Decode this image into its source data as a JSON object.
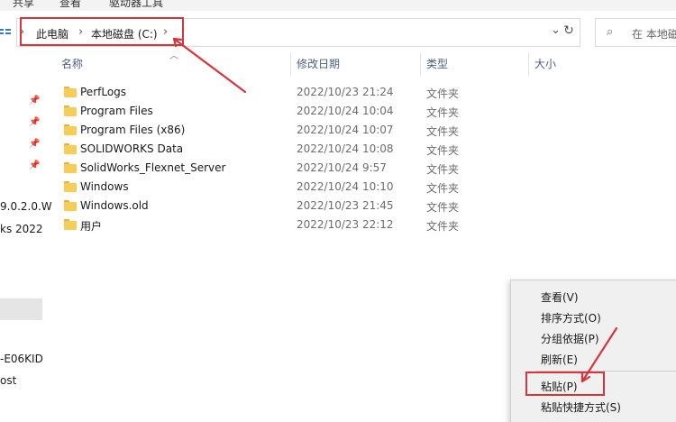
{
  "ribbon": {
    "tabs": [
      "共享",
      "查看",
      "驱动器工具"
    ]
  },
  "breadcrumb": {
    "items": [
      "此电脑",
      "本地磁盘 (C:)"
    ]
  },
  "search": {
    "placeholder": "在 本地磁盘"
  },
  "columns": {
    "name": "名称",
    "date": "修改日期",
    "type": "类型",
    "size": "大小"
  },
  "files": [
    {
      "name": "PerfLogs",
      "date": "2022/10/23 21:24",
      "type": "文件夹"
    },
    {
      "name": "Program Files",
      "date": "2022/10/24 10:04",
      "type": "文件夹"
    },
    {
      "name": "Program Files (x86)",
      "date": "2022/10/24 10:07",
      "type": "文件夹"
    },
    {
      "name": "SOLIDWORKS Data",
      "date": "2022/10/24 10:08",
      "type": "文件夹"
    },
    {
      "name": "SolidWorks_Flexnet_Server",
      "date": "2022/10/24 9:57",
      "type": "文件夹"
    },
    {
      "name": "Windows",
      "date": "2022/10/24 10:10",
      "type": "文件夹"
    },
    {
      "name": "Windows.old",
      "date": "2022/10/23 21:45",
      "type": "文件夹"
    },
    {
      "name": "用户",
      "date": "2022/10/23 22:12",
      "type": "文件夹"
    }
  ],
  "nav_pane": {
    "items": [
      "9.0.2.0.W",
      "ks 2022",
      "-E06KID",
      "ost"
    ]
  },
  "context_menu": {
    "items": [
      "查看(V)",
      "排序方式(O)",
      "分组依据(P)",
      "刷新(E)",
      "粘贴(P)",
      "粘贴快捷方式(S)"
    ]
  },
  "colors": {
    "highlight": "#d8343b",
    "folder": "#f7cd57",
    "header_text": "#4d6082"
  }
}
